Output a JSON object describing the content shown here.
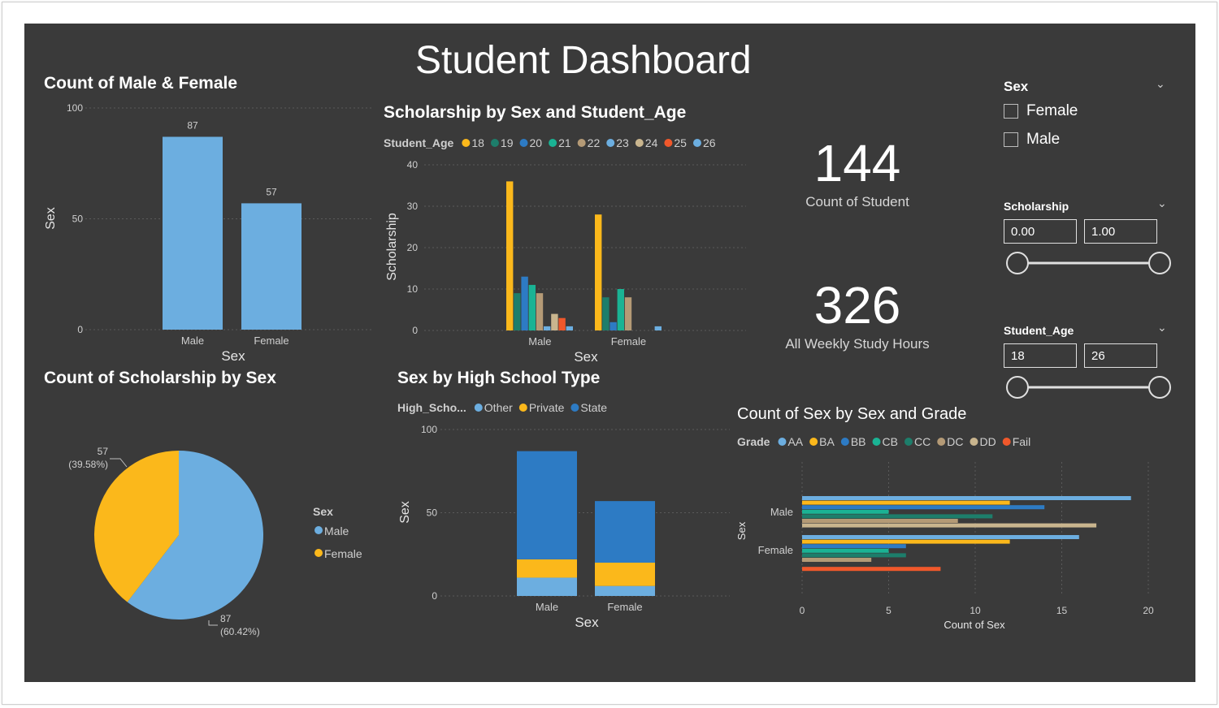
{
  "dashboard_title": "Student Dashboard",
  "colors": {
    "background": "#3a3a3a",
    "light_blue": "#6caee0",
    "gold": "#fbb81b",
    "blue": "#2d7bc4",
    "teal_dark": "#1d7e6b",
    "teal": "#1ab394",
    "tan": "#b49a76",
    "tan_light": "#c9b58e",
    "orange_red": "#f0582b"
  },
  "kpis": [
    {
      "value": "144",
      "label": "Count of Student"
    },
    {
      "value": "326",
      "label": "All Weekly Study Hours"
    }
  ],
  "slicers": {
    "sex": {
      "title": "Sex",
      "options": [
        "Female",
        "Male"
      ]
    },
    "scholarship": {
      "title": "Scholarship",
      "min": "0.00",
      "max": "1.00"
    },
    "student_age": {
      "title": "Student_Age",
      "min": "18",
      "max": "26"
    }
  },
  "chart_data": [
    {
      "type": "bar",
      "title": "Count of Male & Female",
      "xlabel": "Sex",
      "ylabel": "Sex",
      "categories": [
        "Male",
        "Female"
      ],
      "values": [
        87,
        57
      ],
      "ylim": [
        0,
        100
      ],
      "yticks": [
        "100",
        "50",
        "0"
      ],
      "data_labels": [
        "87",
        "57"
      ],
      "color": "#6caee0",
      "grid": true
    },
    {
      "type": "bar",
      "title": "Scholarship by Sex and Student_Age",
      "xlabel": "Sex",
      "ylabel": "Scholarship",
      "legend_title": "Student_Age",
      "categories": [
        "Male",
        "Female"
      ],
      "ylim": [
        0,
        40
      ],
      "yticks": [
        "40",
        "30",
        "20",
        "10",
        "0"
      ],
      "series": [
        {
          "name": "18",
          "color": "#fbb81b",
          "values": [
            36,
            28
          ]
        },
        {
          "name": "19",
          "color": "#1d7e6b",
          "values": [
            9,
            8
          ]
        },
        {
          "name": "20",
          "color": "#2d7bc4",
          "values": [
            13,
            2
          ]
        },
        {
          "name": "21",
          "color": "#1ab394",
          "values": [
            11,
            10
          ]
        },
        {
          "name": "22",
          "color": "#b49a76",
          "values": [
            9,
            8
          ]
        },
        {
          "name": "23",
          "color": "#6caee0",
          "values": [
            1,
            0
          ]
        },
        {
          "name": "24",
          "color": "#c9b58e",
          "values": [
            4,
            0
          ]
        },
        {
          "name": "25",
          "color": "#f0582b",
          "values": [
            3,
            0
          ]
        },
        {
          "name": "26",
          "color": "#6caee0",
          "values": [
            1,
            1
          ]
        }
      ],
      "legend_placement": "top-left",
      "grid": true
    },
    {
      "type": "pie",
      "title": "Count of Scholarship by Sex",
      "legend_title": "Sex",
      "labels": [
        "Male",
        "Female"
      ],
      "values": [
        87,
        57
      ],
      "percent_labels": [
        "(60.42%)",
        "(39.58%)"
      ],
      "value_labels": [
        "87",
        "57"
      ],
      "colors": [
        "#6caee0",
        "#fbb81b"
      ],
      "legend_placement": "right"
    },
    {
      "type": "bar",
      "stacked": true,
      "title": "Sex by High School Type",
      "xlabel": "Sex",
      "ylabel": "Sex",
      "legend_title": "High_Scho...",
      "categories": [
        "Male",
        "Female"
      ],
      "ylim": [
        0,
        100
      ],
      "yticks": [
        "100",
        "50",
        "0"
      ],
      "series": [
        {
          "name": "Other",
          "color": "#6caee0",
          "values": [
            11,
            6
          ]
        },
        {
          "name": "Private",
          "color": "#fbb81b",
          "values": [
            11,
            14
          ]
        },
        {
          "name": "State",
          "color": "#2d7bc4",
          "values": [
            65,
            37
          ]
        }
      ],
      "legend_placement": "top-left",
      "grid": true
    },
    {
      "type": "bar",
      "orientation": "horizontal",
      "title": "Count of Sex by Sex and Grade",
      "xlabel": "Count of Sex",
      "ylabel": "Sex",
      "legend_title": "Grade",
      "categories": [
        "Male",
        "Female"
      ],
      "xlim": [
        0,
        20
      ],
      "xticks": [
        "0",
        "5",
        "10",
        "15",
        "20"
      ],
      "series": [
        {
          "name": "AA",
          "color": "#6caee0",
          "values": [
            19,
            16
          ]
        },
        {
          "name": "BA",
          "color": "#fbb81b",
          "values": [
            12,
            12
          ]
        },
        {
          "name": "BB",
          "color": "#2d7bc4",
          "values": [
            14,
            6
          ]
        },
        {
          "name": "CB",
          "color": "#1ab394",
          "values": [
            5,
            5
          ]
        },
        {
          "name": "CC",
          "color": "#1d7e6b",
          "values": [
            11,
            6
          ]
        },
        {
          "name": "DC",
          "color": "#b49a76",
          "values": [
            9,
            4
          ]
        },
        {
          "name": "DD",
          "color": "#c9b58e",
          "values": [
            17,
            0
          ]
        },
        {
          "name": "Fail",
          "color": "#f0582b",
          "values": [
            0,
            8
          ]
        }
      ],
      "legend_placement": "top-left",
      "grid": true
    }
  ]
}
